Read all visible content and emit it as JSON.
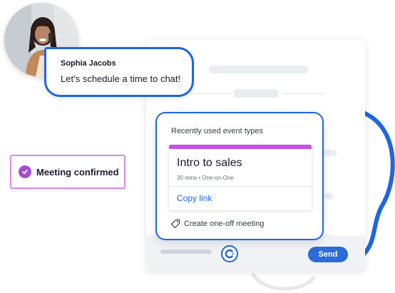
{
  "contact": {
    "name": "Sophia Jacobs",
    "message": "Let’s schedule a time to chat!"
  },
  "confirmation": {
    "label": "Meeting confirmed",
    "icon": "check-circle-icon"
  },
  "event_types": {
    "title": "Recently used event types",
    "items": [
      {
        "name": "Intro to sales",
        "meta": "30 mins • One-on-One",
        "action": "Copy link",
        "color": "#c84fe6"
      }
    ],
    "create_label": "Create one-off meeting"
  },
  "composer": {
    "send_label": "Send"
  },
  "colors": {
    "accent_blue": "#1f66e0",
    "event_purple": "#c84fe6",
    "confirm_purple": "#a54bd1"
  }
}
